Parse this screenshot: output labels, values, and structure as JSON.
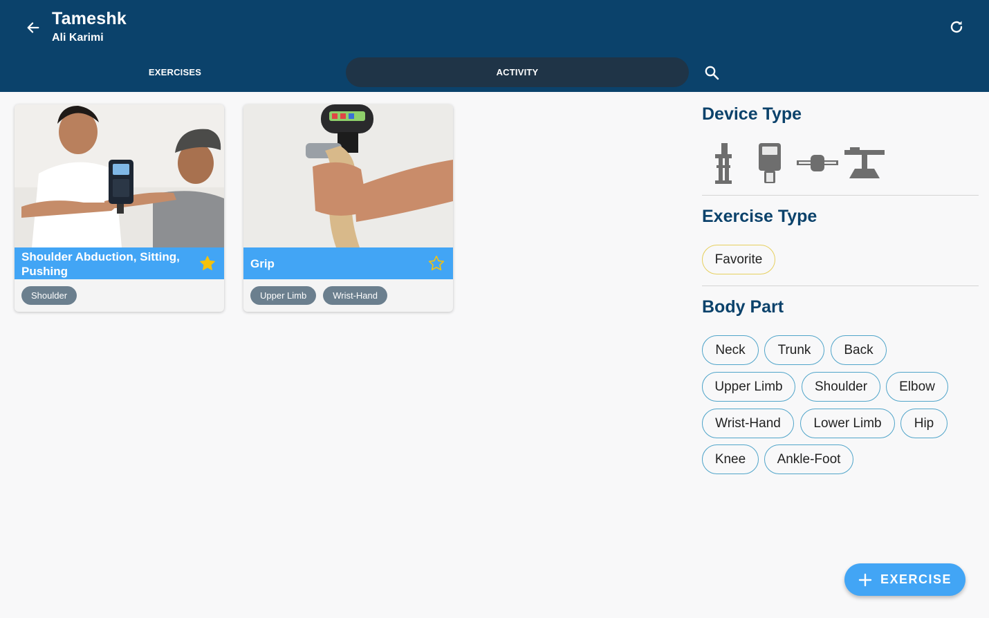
{
  "app": {
    "title": "Tameshk",
    "subtitle": "Ali Karimi"
  },
  "tabs": [
    {
      "label": "EXERCISES"
    },
    {
      "label": "ACTIVITY"
    }
  ],
  "cards": [
    {
      "title": "Shoulder Abduction, Sitting, Pushing",
      "favorite": true,
      "tags": [
        "Shoulder"
      ]
    },
    {
      "title": "Grip",
      "favorite": false,
      "tags": [
        "Upper Limb",
        "Wrist-Hand"
      ]
    }
  ],
  "filters": {
    "device_type": {
      "title": "Device Type",
      "icons": [
        "vertical-dynamometer-icon",
        "handheld-dynamometer-icon",
        "inline-load-cell-icon",
        "platform-dynamometer-icon"
      ]
    },
    "exercise_type": {
      "title": "Exercise Type",
      "options": [
        "Favorite"
      ]
    },
    "body_part": {
      "title": "Body Part",
      "options": [
        "Neck",
        "Trunk",
        "Back",
        "Upper Limb",
        "Shoulder",
        "Elbow",
        "Wrist-Hand",
        "Lower Limb",
        "Hip",
        "Knee",
        "Ankle-Foot"
      ]
    }
  },
  "fab": {
    "label": "EXERCISE"
  },
  "colors": {
    "primary": "#0b426b",
    "accent": "#42a5f5",
    "chip_border": "#4fa4c9",
    "favorite_border": "#e6cf5e",
    "star": "#f4c20d"
  }
}
